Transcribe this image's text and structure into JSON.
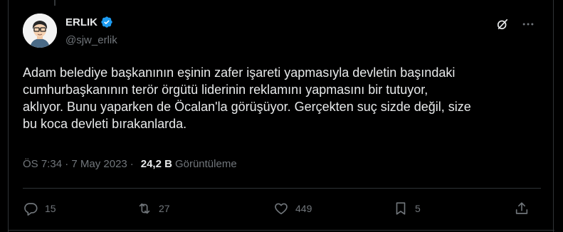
{
  "author": {
    "display_name": "ERLIK",
    "handle": "@sjw_erlik",
    "verified": true
  },
  "tweet": {
    "text": "Adam belediye başkanının eşinin zafer işareti yapmasıyla devletin başındaki\ncumhurbaşkanının terör örgütü liderinin reklamını yapmasını bir tutuyor,\naklıyor. Bunu yaparken de Öcalan'la görüşüyor. Gerçekten suç sizde değil, size\nbu koca devleti bırakanlarda.",
    "timestamp": "ÖS 7:34 · 7 May 2023",
    "views_count": "24,2 B",
    "views_label": "Görüntüleme"
  },
  "actions": {
    "replies": "15",
    "reposts": "27",
    "likes": "449",
    "bookmarks": "5"
  },
  "colors": {
    "background": "#000000",
    "text_primary": "#e7e9ea",
    "text_secondary": "#71767b",
    "verified": "#1d9bf0",
    "border": "#2f3336"
  },
  "icons": {
    "grok": "grok-icon",
    "more": "more-icon",
    "reply": "reply-icon",
    "repost": "repost-icon",
    "like": "heart-icon",
    "bookmark": "bookmark-icon",
    "share": "share-icon"
  }
}
